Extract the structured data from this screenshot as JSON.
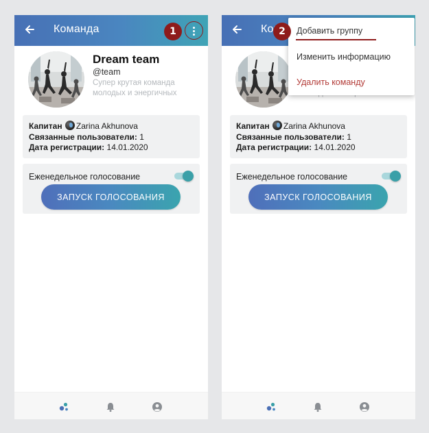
{
  "screen": {
    "title": "Команда",
    "team": {
      "name": "Dream team",
      "handle": "@team",
      "description": "Супер крутая команда молодых и энергичных"
    },
    "info": {
      "captain_label": "Капитан",
      "captain_name": "Zarina Akhunova",
      "linked_users_label": "Связанные пользователи:",
      "linked_users_value": "1",
      "registration_label": "Дата регистрации:",
      "registration_value": "14.01.2020"
    },
    "voting": {
      "label": "Еженедельное голосование",
      "toggle_on": true,
      "button": "ЗАПУСК ГОЛОСОВАНИЯ"
    },
    "bottom_nav": [
      "teams-icon",
      "bell-icon",
      "profile-icon"
    ]
  },
  "menu": {
    "items": [
      "Добавить группу",
      "Изменить информацию",
      "Удалить команду"
    ]
  },
  "annotations": {
    "step1": "1",
    "step2": "2"
  },
  "colors": {
    "header_start": "#4770b5",
    "header_end": "#3fa4b6",
    "accent_teal": "#3aa0a8",
    "badge": "#8e1b1b",
    "delete_text": "#b23a36"
  }
}
